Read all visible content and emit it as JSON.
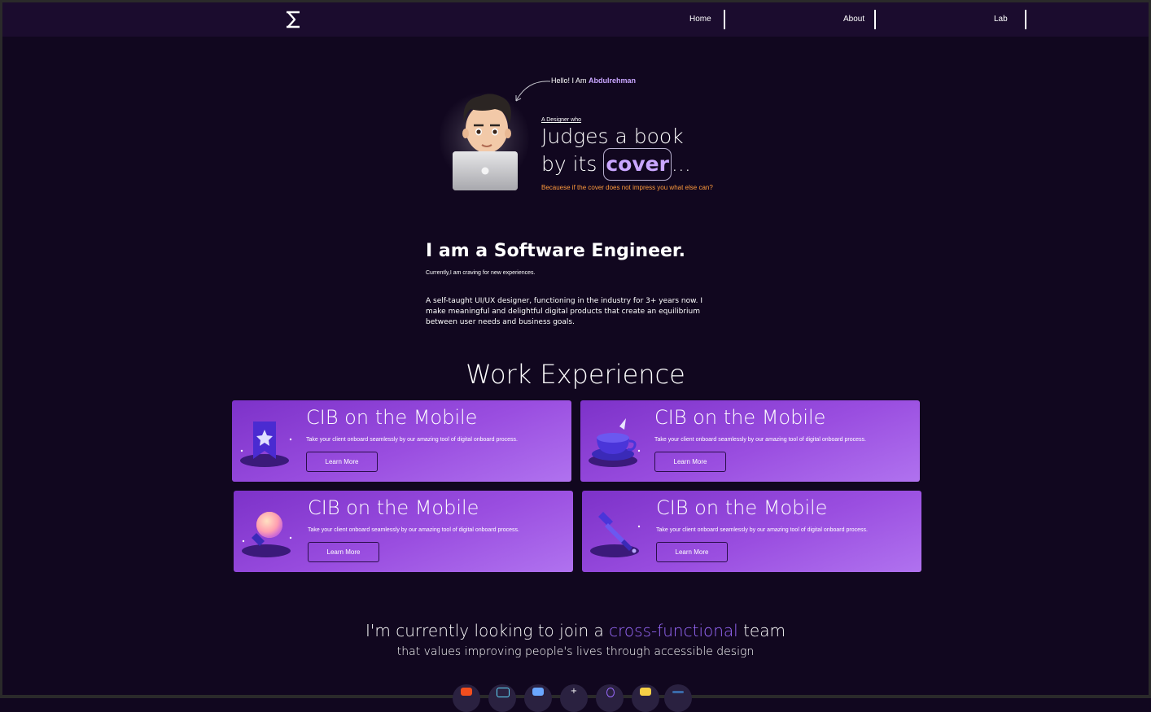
{
  "nav": {
    "logo": "logo-icon",
    "links": [
      "Home",
      "About",
      "Lab"
    ]
  },
  "hero": {
    "hello_prefix": "Hello! I Am",
    "hello_name": "Abdulrehman",
    "designer_label": "A Designer who",
    "line1": "Judges a book",
    "line2_prefix": "by its",
    "line2_highlight": "cover",
    "line2_suffix": "...",
    "tagline": "Becauese if the cover does not impress you what else can?",
    "tagline_color": "#ff9a3c",
    "highlight_color": "#c9a6ff"
  },
  "about": {
    "title": "I am a Software Engineer.",
    "subtitle": "Currently,I am craving for new experiences.",
    "bio": "A self-taught UI/UX designer, functioning in the industry for 3+ years now. I make meaningful and delightful digital products that create an equilibrium between user needs and business goals."
  },
  "work": {
    "title": "Work Experience",
    "cards": [
      {
        "title": "CIB on the Mobile",
        "desc": "Take your client onboard seamlessly by our amazing tool of digital onboard process.",
        "button": "Learn More",
        "icon": "bookmark-star-icon"
      },
      {
        "title": "CIB on the Mobile",
        "desc": "Take your client onboard seamlessly by our amazing tool of digital onboard process.",
        "button": "Learn More",
        "icon": "teacup-icon"
      },
      {
        "title": "CIB on the Mobile",
        "desc": "Take your client onboard seamlessly by our amazing tool of digital onboard process.",
        "button": "Learn More",
        "icon": "lightbulb-icon"
      },
      {
        "title": "CIB on the Mobile",
        "desc": "Take your client onboard seamlessly by our amazing tool of digital onboard process.",
        "button": "Learn More",
        "icon": "dropper-icon"
      }
    ]
  },
  "cta": {
    "prefix": "I'm currently looking to join a",
    "highlight": "cross-functional",
    "suffix": "team",
    "sub": "that values improving people's lives through accessible design"
  },
  "tools": [
    "figma-icon",
    "react-icon",
    "sketch-icon",
    "add-icon",
    "search-icon",
    "notes-icon",
    "menu-icon"
  ],
  "colors": {
    "background": "#11071f",
    "nav": "#1b0c2e",
    "card_start": "#7d32c9",
    "card_end": "#b072ef",
    "accent": "#9b6bff"
  }
}
